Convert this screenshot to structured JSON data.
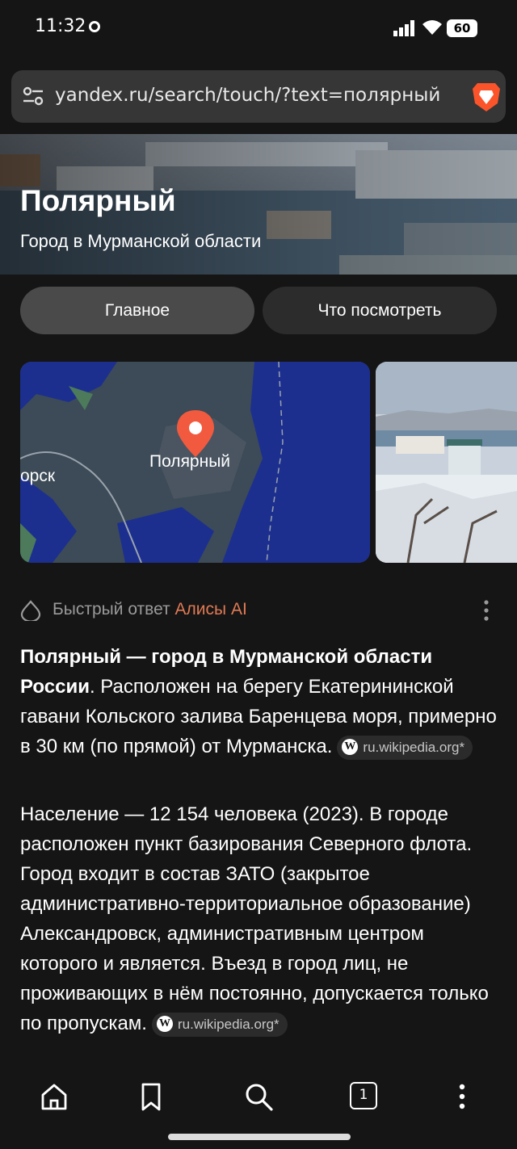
{
  "status_bar": {
    "time": "11:32",
    "battery": "60"
  },
  "browser": {
    "url": "yandex.ru/search/touch/?text=полярный"
  },
  "hero": {
    "title": "Полярный",
    "subtitle": "Город в Мурманской области"
  },
  "tabs": [
    {
      "label": "Главное",
      "active": true
    },
    {
      "label": "Что посмотреть",
      "active": false
    }
  ],
  "map": {
    "place_label": "Полярный",
    "neighbor_label": "орск"
  },
  "answer": {
    "header_prefix": "Быстрый ответ ",
    "header_brand": "Алисы AI",
    "p1_bold": "Полярный — город в Мурманской области России",
    "p1_rest": ". Расположен на берегу Екатерининской гавани Кольского залива Баренцева моря, примерно в 30 км (по прямой) от Мурманска.",
    "p1_source": "ru.wikipedia.org*",
    "p2_text": "Население — 12 154 человека (2023). В городе расположен пункт базирования Северного флота. Город входит в состав ЗАТО (закрытое административно-территориальное образование) Александровск, административным центром которого и является. Въезд в город лиц, не проживающих в нём постоянно, допускается только по пропускам.",
    "p2_source": "ru.wikipedia.org*",
    "source_icon_letter": "W"
  },
  "bottom_nav": {
    "tab_count": "1",
    "items": [
      "home-icon",
      "bookmark-icon",
      "search-icon",
      "tabs-icon",
      "more-icon"
    ]
  },
  "colors": {
    "background": "#151515",
    "accent_ai": "#e07a55",
    "brave": "#fb542b",
    "map_water": "#1c2f8f",
    "map_land": "#3c4b57"
  }
}
